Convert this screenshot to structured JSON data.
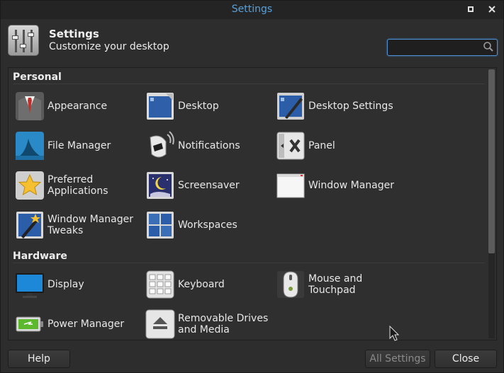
{
  "window": {
    "title": "Settings"
  },
  "header": {
    "title": "Settings",
    "subtitle": "Customize your desktop",
    "search_placeholder": ""
  },
  "sections": {
    "personal": "Personal",
    "hardware": "Hardware"
  },
  "items": {
    "appearance": "Appearance",
    "desktop": "Desktop",
    "desktop_settings": "Desktop Settings",
    "file_manager": "File Manager",
    "notifications": "Notifications",
    "panel": "Panel",
    "preferred_applications_1": "Preferred",
    "preferred_applications_2": "Applications",
    "screensaver": "Screensaver",
    "window_manager": "Window Manager",
    "wm_tweaks_1": "Window Manager",
    "wm_tweaks_2": "Tweaks",
    "workspaces": "Workspaces",
    "display": "Display",
    "keyboard": "Keyboard",
    "mouse_1": "Mouse and",
    "mouse_2": "Touchpad",
    "power_manager": "Power Manager",
    "removable_1": "Removable Drives",
    "removable_2": "and Media"
  },
  "footer": {
    "help": "Help",
    "all_settings": "All Settings",
    "close": "Close"
  },
  "colors": {
    "title_accent": "#5aa0d8",
    "search_border": "#4f8fd0"
  }
}
